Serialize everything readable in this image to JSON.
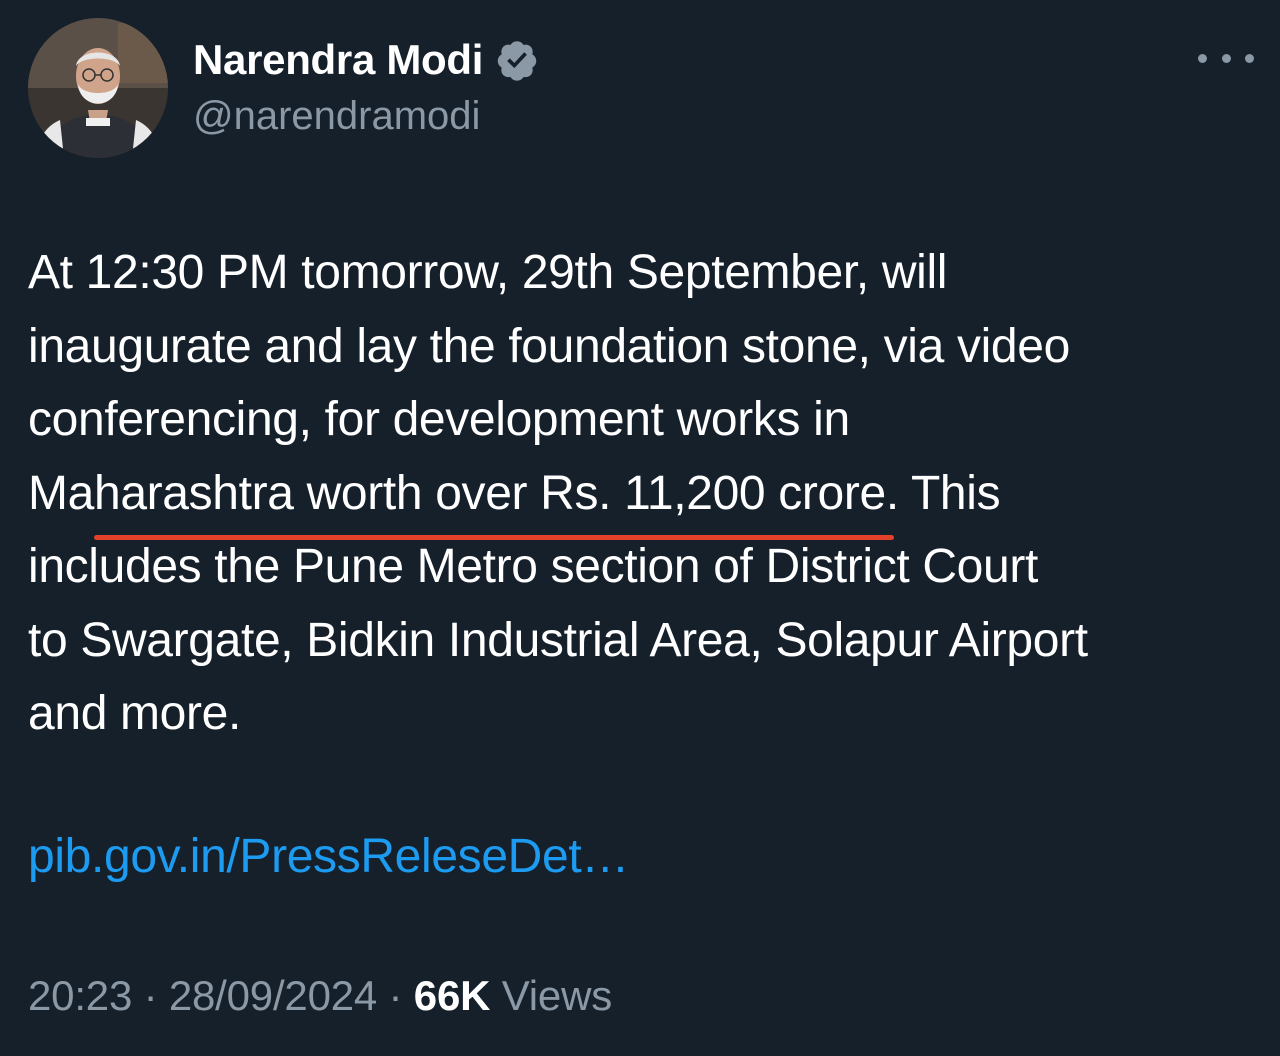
{
  "author": {
    "display_name": "Narendra Modi",
    "handle": "@narendramodi",
    "verified": true,
    "avatar_icon": "profile-photo"
  },
  "menu": {
    "icon": "more-horizontal-icon"
  },
  "tweet": {
    "lines": [
      "At 12:30 PM tomorrow, 29th September, will",
      "inaugurate and lay the foundation stone, via video",
      "conferencing, for development works in"
    ],
    "line4_pre": "Ma",
    "line4_highlight": "harashtra worth over Rs. 11,200 crore",
    "line4_post": ". This",
    "lines_after": [
      "includes the Pune Metro section of District Court",
      "to Swargate, Bidkin Industrial Area, Solapur Airport",
      "and more."
    ],
    "link_text": "pib.gov.in/PressReleseDet…"
  },
  "meta": {
    "time": "20:23",
    "separator": " · ",
    "date": "28/09/2024",
    "views_count": "66K",
    "views_label": " Views"
  },
  "colors": {
    "background": "#15202b",
    "text": "#ffffff",
    "secondary": "#8b98a5",
    "link": "#1d9bf0",
    "verified_badge": "#8b98a5",
    "highlight_underline": "#e4412b"
  }
}
